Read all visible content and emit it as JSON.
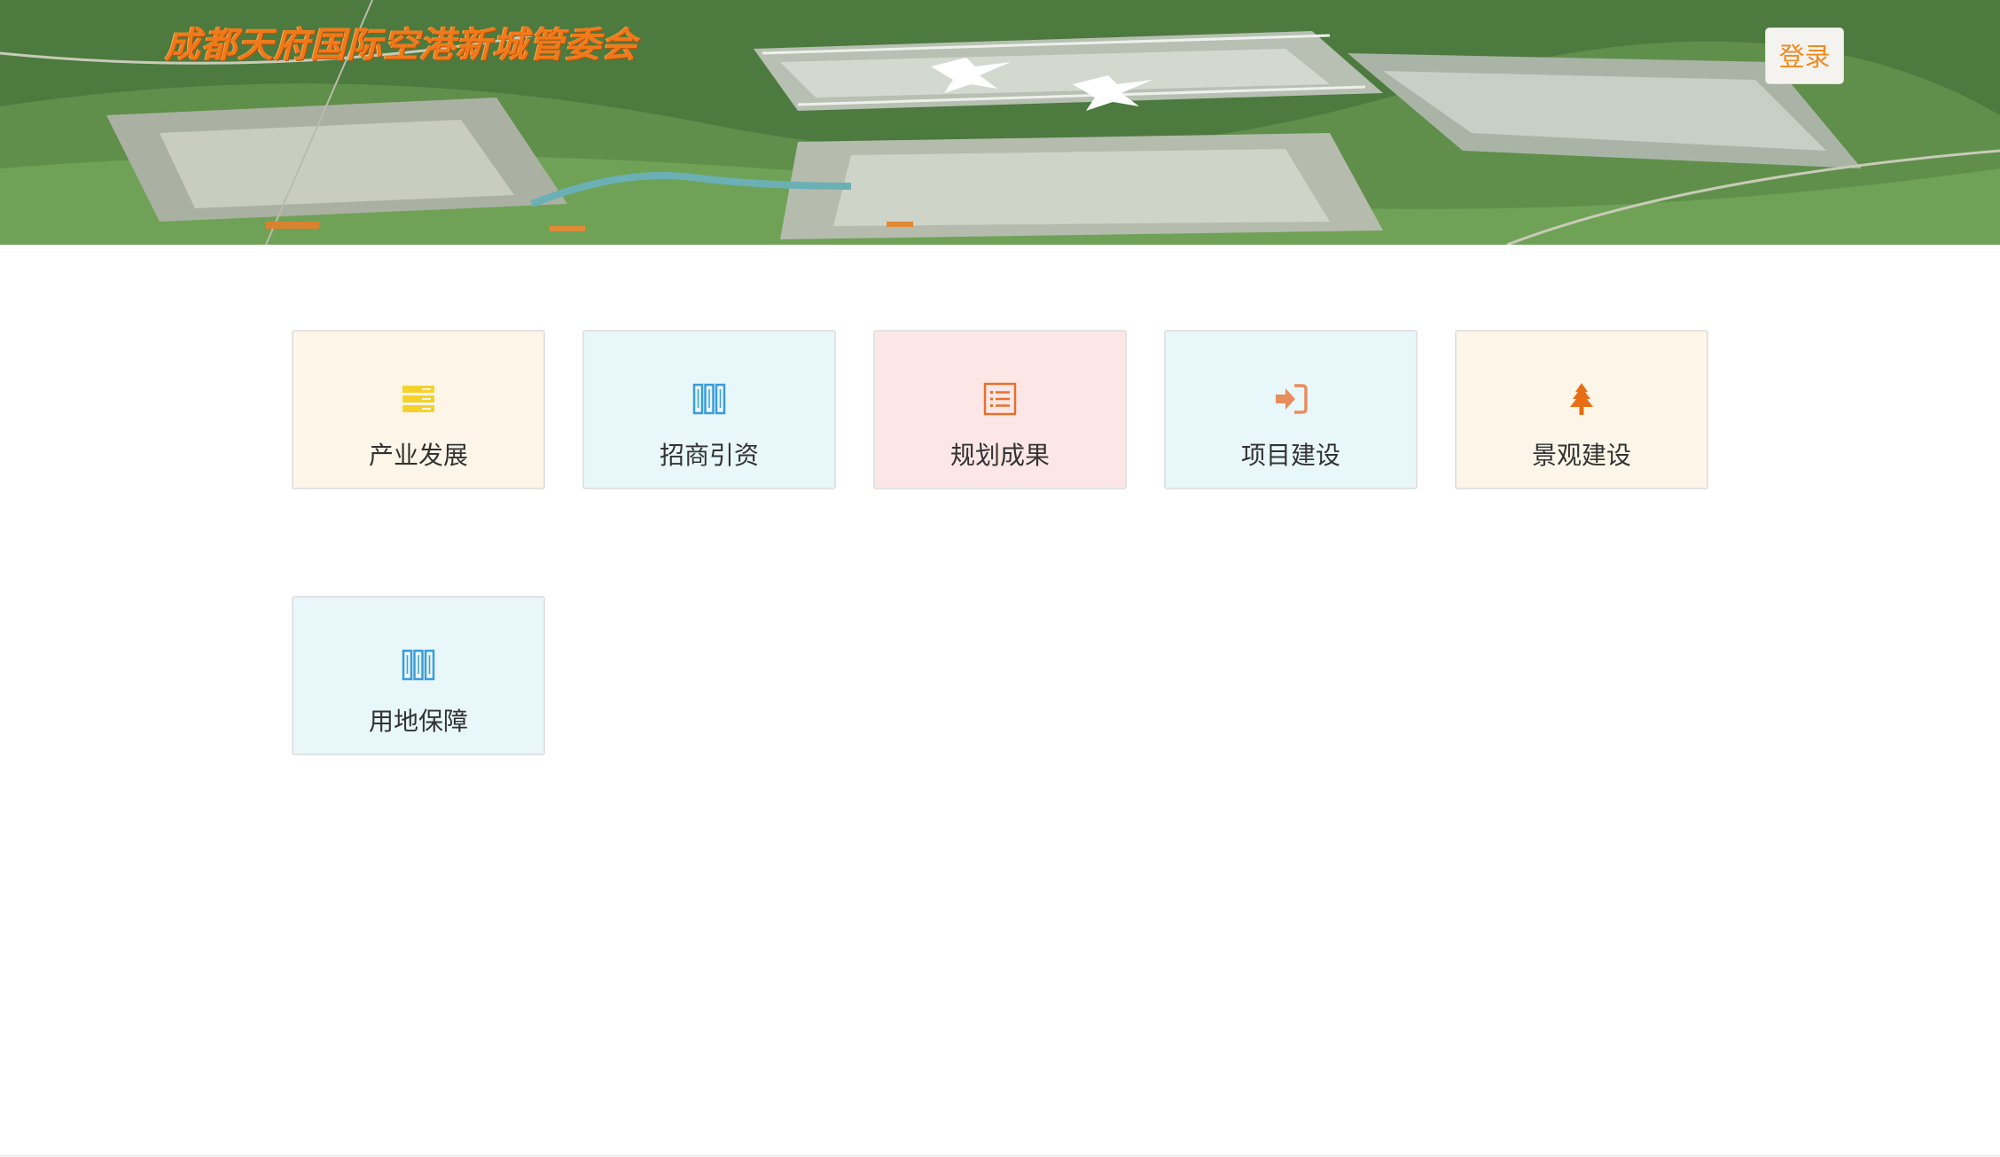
{
  "header": {
    "site_title": "成都天府国际空港新城管委会",
    "login_label": "登录"
  },
  "tiles": [
    {
      "label": "产业发展",
      "icon": "server-stack-icon",
      "bg": "#fdf6e8",
      "icon_color": "#f5d22a"
    },
    {
      "label": "招商引资",
      "icon": "books-icon",
      "bg": "#e8f7f9",
      "icon_color": "#3a9ddc"
    },
    {
      "label": "规划成果",
      "icon": "list-icon",
      "bg": "#fce7e6",
      "icon_color": "#e8702c"
    },
    {
      "label": "项目建设",
      "icon": "sign-in-icon",
      "bg": "#e8f7f9",
      "icon_color": "#e88d5c"
    },
    {
      "label": "景观建设",
      "icon": "tree-icon",
      "bg": "#fdf6e8",
      "icon_color": "#e86e16"
    },
    {
      "label": "用地保障",
      "icon": "books-icon",
      "bg": "#e8f7f9",
      "icon_color": "#3a9ddc"
    }
  ]
}
